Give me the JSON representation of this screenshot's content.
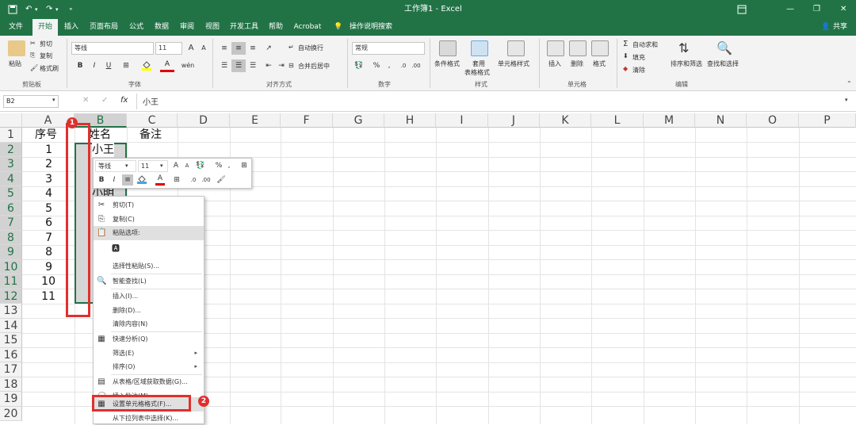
{
  "title_bar": {
    "quick_icons": [
      "save-icon",
      "undo-icon",
      "redo-icon",
      "customize-icon"
    ],
    "title": "工作簿1 - Excel",
    "window_controls": [
      "ribbon-display-icon",
      "minimize-icon",
      "restore-icon",
      "close-icon"
    ]
  },
  "tabs": [
    "文件",
    "开始",
    "插入",
    "页面布局",
    "公式",
    "数据",
    "审阅",
    "视图",
    "开发工具",
    "帮助",
    "Acrobat"
  ],
  "active_tab": "开始",
  "tell_me": "操作说明搜索",
  "share": "共享",
  "ribbon": {
    "clipboard": {
      "paste": "粘贴",
      "cut": "剪切",
      "copy": "复制",
      "format_painter": "格式刷",
      "group": "剪贴板"
    },
    "font": {
      "name": "等线",
      "size": "11",
      "grow": "A",
      "shrink": "A",
      "bold": "B",
      "italic": "I",
      "underline": "U",
      "pinyin": "wén",
      "group": "字体"
    },
    "alignment": {
      "wrap": "自动换行",
      "merge": "合并后居中",
      "group": "对齐方式"
    },
    "number": {
      "format": "常规",
      "percent": "%",
      "comma": ",",
      "group": "数字"
    },
    "styles": {
      "conditional": "条件格式",
      "table_line1": "套用",
      "table_line2": "表格格式",
      "cell_styles": "单元格样式",
      "group": "样式"
    },
    "cells": {
      "insert": "插入",
      "delete": "删除",
      "format": "格式",
      "group": "单元格"
    },
    "editing": {
      "autosum": "自动求和",
      "fill": "填充",
      "clear": "清除",
      "sort_filter": "排序和筛选",
      "find_select": "查找和选择",
      "group": "编辑"
    }
  },
  "formula_bar": {
    "name_box": "B2",
    "cancel": "✕",
    "enter": "✓",
    "fx": "fx",
    "content": "小王"
  },
  "columns": [
    "A",
    "B",
    "C",
    "D",
    "E",
    "F",
    "G",
    "H",
    "I",
    "J",
    "K",
    "L",
    "M",
    "N",
    "O",
    "P"
  ],
  "rows": [
    "1",
    "2",
    "3",
    "4",
    "5",
    "6",
    "7",
    "8",
    "9",
    "10",
    "11",
    "12",
    "13",
    "14",
    "15",
    "16",
    "17",
    "18",
    "19",
    "20"
  ],
  "cells": {
    "a1": "序号",
    "b1": "姓名",
    "c1": "备注",
    "a_values": [
      "1",
      "2",
      "3",
      "4",
      "5",
      "6",
      "7",
      "8",
      "9",
      "10",
      "11"
    ],
    "b2": "小王",
    "b5": "小明"
  },
  "mini_toolbar": {
    "font": "等线",
    "size": "11",
    "grow": "A",
    "shrink": "A",
    "percent": "%",
    "comma": ",",
    "bold": "B",
    "italic": "I",
    "align": "≡",
    "font_color_letter": "A"
  },
  "context_menu": {
    "items": [
      {
        "label": "剪切(T)",
        "icon": "scissors-icon"
      },
      {
        "label": "复制(C)",
        "icon": "copy-icon"
      },
      {
        "label": "粘贴选项:",
        "icon": "paste-icon",
        "highlighted": true
      },
      {
        "label": "",
        "icon": "paste-text-icon"
      },
      {
        "label": "选择性粘贴(S)...",
        "icon": ""
      },
      {
        "label": "智能查找(L)",
        "icon": "search-icon"
      },
      {
        "label": "插入(I)...",
        "icon": ""
      },
      {
        "label": "删除(D)...",
        "icon": ""
      },
      {
        "label": "清除内容(N)",
        "icon": ""
      },
      {
        "label": "快速分析(Q)",
        "icon": "quick-analysis-icon"
      },
      {
        "label": "筛选(E)",
        "icon": "",
        "submenu": true
      },
      {
        "label": "排序(O)",
        "icon": "",
        "submenu": true
      },
      {
        "label": "从表格/区域获取数据(G)...",
        "icon": "table-icon"
      },
      {
        "label": "插入批注(M)",
        "icon": "comment-icon"
      },
      {
        "label": "设置单元格格式(F)...",
        "icon": "format-cells-icon"
      },
      {
        "label": "从下拉列表中选择(K)...",
        "icon": ""
      }
    ]
  },
  "annotations": {
    "badge1": "1",
    "badge2": "2"
  },
  "colors": {
    "excel_green": "#217346",
    "annotation_red": "#e0302e"
  }
}
